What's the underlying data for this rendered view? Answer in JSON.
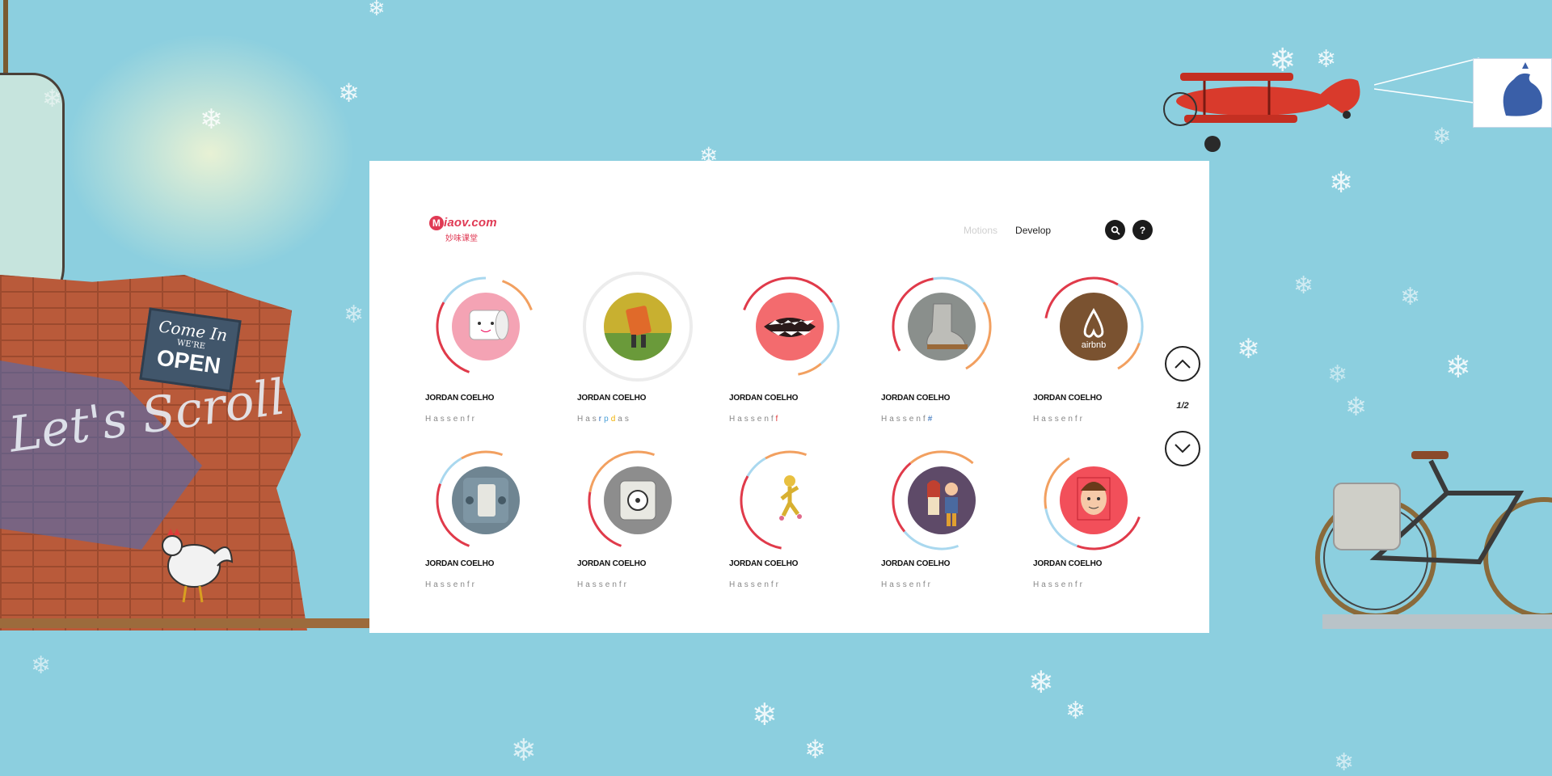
{
  "background": {
    "sign": {
      "line1": "Come In",
      "line2": "WE'RE",
      "line3": "OPEN"
    },
    "wall_script": "Let's Scroll",
    "colors": {
      "sky": "#8ccfdf",
      "brick": "#b95a3a",
      "plane": "#d93a2c"
    }
  },
  "card": {
    "logo": {
      "main": "iaov.com",
      "badge": "M",
      "sub": "妙味课堂",
      "color": "#e03a54"
    },
    "nav": {
      "items": [
        {
          "label": "Motions",
          "state": "inactive"
        },
        {
          "label": "Develop",
          "state": "active"
        }
      ]
    },
    "actions": {
      "search_icon": "?",
      "search_name": "search-icon",
      "help_label": "?"
    },
    "pager": {
      "label": "1/2",
      "up_icon": "chevron-up-icon",
      "down_icon": "chevron-down-icon"
    },
    "tiles": [
      {
        "name": "JORDAN COELHO",
        "sub": "Hassenfr",
        "art": "toilet-paper",
        "avatar_color": "#f4a3b4"
      },
      {
        "name": "JORDAN COELHO",
        "sub": "Hasrpdas",
        "art": "dancing-robot",
        "avatar_color": "#c8b030"
      },
      {
        "name": "JORDAN COELHO",
        "sub": "Hassenff",
        "art": "mouth",
        "avatar_color": "#f36b6e"
      },
      {
        "name": "JORDAN COELHO",
        "sub": "Hassenf#",
        "art": "boot",
        "avatar_color": "#8a8f8c"
      },
      {
        "name": "JORDAN COELHO",
        "sub": "Hassenfr",
        "art": "airbnb",
        "avatar_color": "#7a5230",
        "art_label": "airbnb"
      },
      {
        "name": "JORDAN COELHO",
        "sub": "Hassenfr",
        "art": "gadget",
        "avatar_color": "#6f8592"
      },
      {
        "name": "JORDAN COELHO",
        "sub": "Hassenfr",
        "art": "speaker",
        "avatar_color": "#8d8d8d"
      },
      {
        "name": "JORDAN COELHO",
        "sub": "Hassenfr",
        "art": "runner",
        "avatar_color": "#ffffff"
      },
      {
        "name": "JORDAN COELHO",
        "sub": "Hassenfr",
        "art": "couple",
        "avatar_color": "#5e4a68"
      },
      {
        "name": "JORDAN COELHO",
        "sub": "Hassenfr",
        "art": "face",
        "avatar_color": "#f24f5a"
      }
    ]
  }
}
